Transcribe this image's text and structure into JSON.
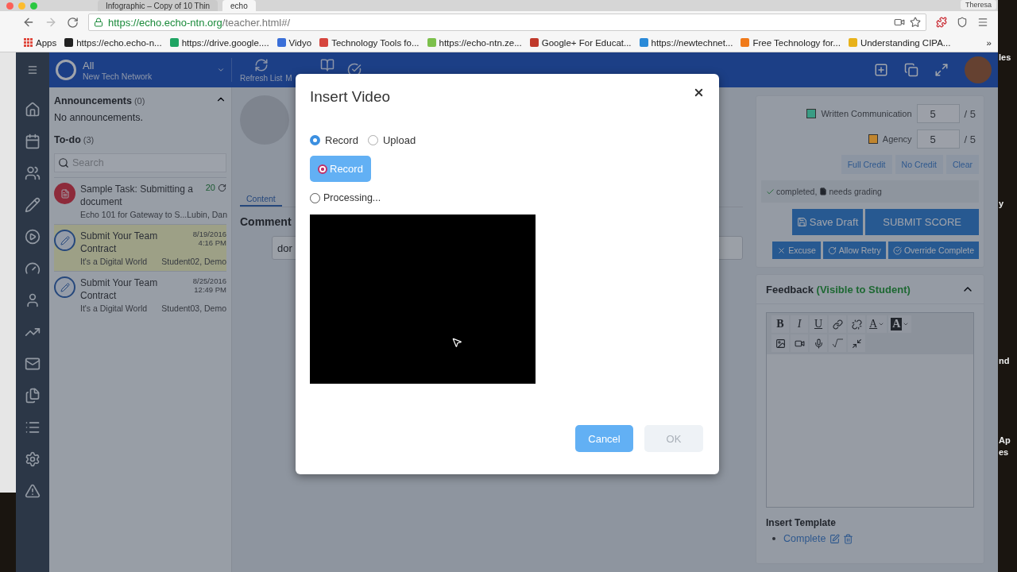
{
  "browser": {
    "tabs": [
      {
        "title": "Infographic – Copy of 10 Thin",
        "selected": false
      },
      {
        "title": "echo",
        "selected": true
      }
    ],
    "profile": "Theresa",
    "url": {
      "host": "https://echo.echo-ntn.org",
      "path": "/teacher.html#/"
    },
    "bookmarks": [
      {
        "kind": "apps",
        "label": "Apps",
        "color": "#e04a3f"
      },
      {
        "kind": "link",
        "label": "https://echo.echo-n...",
        "color": "#222222"
      },
      {
        "kind": "link",
        "label": "https://drive.google....",
        "color": "#1fa463"
      },
      {
        "kind": "link",
        "label": "Vidyo",
        "color": "#3a6fd8"
      },
      {
        "kind": "link",
        "label": "Technology Tools fo...",
        "color": "#d6453d"
      },
      {
        "kind": "link",
        "label": "https://echo-ntn.ze...",
        "color": "#7cc04b"
      },
      {
        "kind": "link",
        "label": "Google+ For Educat...",
        "color": "#c0392b"
      },
      {
        "kind": "link",
        "label": "https://newtechnet...",
        "color": "#2a8ad8"
      },
      {
        "kind": "link",
        "label": "Free Technology for...",
        "color": "#f07a1a"
      },
      {
        "kind": "link",
        "label": "Understanding CIPA...",
        "color": "#e8b21a"
      }
    ],
    "bookmarks_more": "»"
  },
  "header": {
    "scope": "All",
    "network": "New Tech Network",
    "toolbar": [
      {
        "kind": "refresh",
        "label": "Refresh List"
      },
      {
        "kind": "book",
        "label": "M"
      },
      {
        "kind": "check"
      }
    ]
  },
  "announcements": {
    "title": "Announcements",
    "count": "(0)",
    "expanded": true,
    "empty_text": "No announcements."
  },
  "todo": {
    "title": "To-do",
    "count": "(3)",
    "search_placeholder": "Search",
    "items": [
      {
        "kind": "document",
        "title": "Sample Task: Submitting a document",
        "date": "20",
        "course": "Echo 101 for Gateway to S...",
        "student": "Lubin, Dan",
        "selected": false
      },
      {
        "kind": "contract",
        "title": "Submit Your Team Contract",
        "date": "8/19/2016",
        "time": "4:16 PM",
        "course": "It's a Digital World",
        "student": "Student02, Demo",
        "selected": true
      },
      {
        "kind": "contract",
        "title": "Submit Your Team Contract",
        "date": "8/25/2016",
        "time": "12:49 PM",
        "course": "It's a Digital World",
        "student": "Student03, Demo",
        "selected": false
      }
    ]
  },
  "content": {
    "tabs": [
      {
        "label": "Content",
        "selected": true
      }
    ],
    "heading": "Comment",
    "comment_value": "dor"
  },
  "grading": {
    "criteria": [
      {
        "name": "Written Communication",
        "color": "#3a9c84",
        "score": "5",
        "max": "/ 5"
      },
      {
        "name": "Agency",
        "color": "#c0852e",
        "score": "5",
        "max": "/ 5"
      }
    ],
    "credit_buttons": [
      "Full Credit",
      "No Credit",
      "Clear"
    ],
    "status": [
      {
        "kind": "check",
        "text": "completed,"
      },
      {
        "kind": "file",
        "text": "needs grading"
      }
    ],
    "save_draft": "Save Draft",
    "submit": "SUBMIT SCORE",
    "actions": [
      {
        "kind": "excuse",
        "label": "Excuse"
      },
      {
        "kind": "retry",
        "label": "Allow Retry"
      },
      {
        "kind": "override",
        "label": "Override Complete"
      }
    ]
  },
  "feedback": {
    "title": "Feedback",
    "note": "(Visible to Student)",
    "expanded": true,
    "toolbar_rows": [
      {
        "tools": [
          {
            "kind": "bold",
            "label": "B"
          },
          {
            "kind": "italic",
            "label": "I"
          },
          {
            "kind": "underline",
            "label": "U"
          },
          {
            "kind": "link"
          },
          {
            "kind": "unlink"
          },
          {
            "kind": "font-color",
            "label": "A"
          },
          {
            "kind": "back-color",
            "label": "A"
          }
        ]
      },
      {
        "tools": [
          {
            "kind": "image"
          },
          {
            "kind": "video"
          },
          {
            "kind": "mic"
          },
          {
            "kind": "math"
          },
          {
            "kind": "fullscreen"
          }
        ]
      }
    ],
    "template_title": "Insert Template",
    "templates": [
      "Complete"
    ]
  },
  "dialog": {
    "title": "Insert Video",
    "modes": [
      {
        "label": "Record",
        "selected": true
      },
      {
        "label": "Upload",
        "selected": false
      }
    ],
    "record_button": "Record",
    "status": "Processing...",
    "buttons": [
      {
        "kind": "cancel",
        "label": "Cancel",
        "disabled": false
      },
      {
        "kind": "ok",
        "label": "OK",
        "disabled": true
      }
    ]
  },
  "desktop_edge_texts": [
    "les",
    "y",
    "nd",
    "Ap",
    "es"
  ]
}
